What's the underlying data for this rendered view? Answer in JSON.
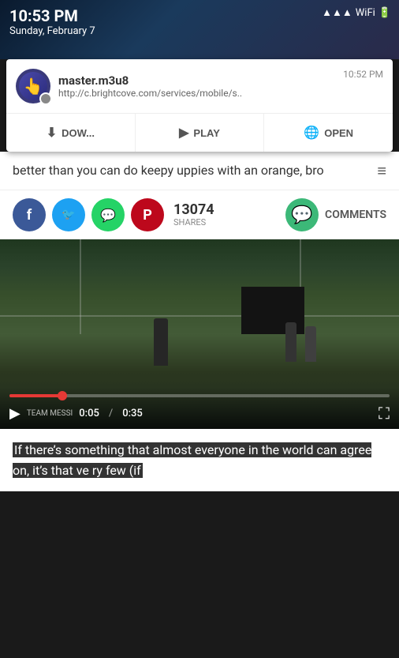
{
  "statusBar": {
    "time": "10:53 PM",
    "date": "Sunday, February 7"
  },
  "notification": {
    "appName": "master.m3u8",
    "url": "http://c.brightcove.com/services/mobile/s..",
    "time": "10:52 PM",
    "actions": {
      "download": "DOW...",
      "play": "PLAY",
      "open": "OPEN"
    }
  },
  "article": {
    "text": "better than you can do keepy uppies with an orange, bro"
  },
  "social": {
    "shares_count": "13074",
    "shares_label": "SHARES",
    "comments_label": "COMMENTS"
  },
  "video": {
    "current_time": "0:05",
    "total_time": "0:35",
    "channel": "TEAM MESSI"
  },
  "bottomArticle": {
    "text": "If there’s something that almost everyone in the world can agree on, it’s that ve",
    "highlight": "ry few (if"
  }
}
